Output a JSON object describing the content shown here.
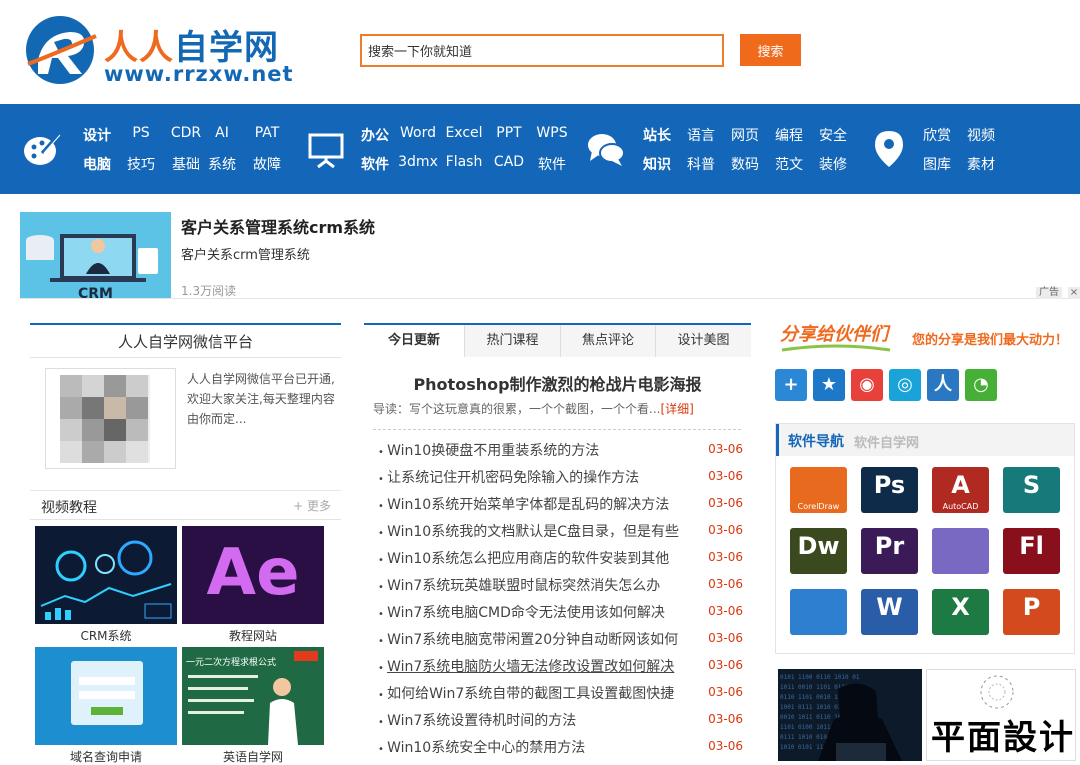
{
  "header": {
    "logo_cn_a": "人人",
    "logo_cn_b": "自学网",
    "logo_url": "www.rrzxw.net",
    "search_value": "搜索一下你就知道",
    "search_button": "搜索"
  },
  "nav": {
    "design_top": [
      "设计",
      "PS",
      "CDR",
      "AI",
      "PAT"
    ],
    "design_bottom": [
      "电脑",
      "技巧",
      "基础",
      "系统",
      "故障"
    ],
    "office_top": [
      "办公",
      "Word",
      "Excel",
      "PPT",
      "WPS"
    ],
    "office_bottom": [
      "软件",
      "3dmx",
      "Flash",
      "CAD",
      "软件"
    ],
    "web_top": [
      "站长",
      "语言",
      "网页",
      "编程",
      "安全"
    ],
    "web_bottom": [
      "知识",
      "科普",
      "数码",
      "范文",
      "装修"
    ],
    "fun_top": [
      "欣赏",
      "视频"
    ],
    "fun_bottom": [
      "图库",
      "素材"
    ]
  },
  "ad": {
    "title": "客户关系管理系统crm系统",
    "desc": "客户关系crm管理系统",
    "views": "1.3万阅读",
    "image_label": "CRM",
    "tag": "广告",
    "close": "×"
  },
  "wechat": {
    "title": "人人自学网微信平台",
    "text": "人人自学网微信平台已开通,欢迎大家关注,每天整理内容由你而定..."
  },
  "video": {
    "title": "视频教程",
    "more": "+ 更多",
    "items": [
      "CRM系统",
      "教程网站",
      "域名查询申请",
      "英语自学网"
    ],
    "thumb_ae": "Ae",
    "thumb_english": "一元二次方程求根公式"
  },
  "tabs": [
    "今日更新",
    "热门课程",
    "焦点评论",
    "设计美图"
  ],
  "featured": {
    "title": "Photoshop制作激烈的枪战片电影海报",
    "intro": "导读：写个这玩意真的很累，一个个截图，一个个看...",
    "more": "[详细]"
  },
  "news": [
    {
      "title": "Win10换硬盘不用重装系统的方法",
      "date": "03-06"
    },
    {
      "title": "让系统记住开机密码免除输入的操作方法",
      "date": "03-06"
    },
    {
      "title": "Win10系统开始菜单字体都是乱码的解决方法",
      "date": "03-06"
    },
    {
      "title": "Win10系统我的文档默认是C盘目录，但是有些",
      "date": "03-06"
    },
    {
      "title": "Win10系统怎么把应用商店的软件安装到其他",
      "date": "03-06"
    },
    {
      "title": "Win7系统玩英雄联盟时鼠标突然消失怎么办",
      "date": "03-06"
    },
    {
      "title": "Win7系统电脑CMD命令无法使用该如何解决",
      "date": "03-06"
    },
    {
      "title": "Win7系统电脑宽带闲置20分钟自动断网该如何",
      "date": "03-06"
    },
    {
      "title": "Win7系统电脑防火墙无法修改设置改如何解决",
      "date": "03-06"
    },
    {
      "title": "如何给Win7系统自带的截图工具设置截图快捷",
      "date": "03-06"
    },
    {
      "title": "Win7系统设置待机时间的方法",
      "date": "03-06"
    },
    {
      "title": "Win10系统安全中心的禁用方法",
      "date": "03-06"
    }
  ],
  "share": {
    "banner": "分享给伙伴们",
    "slogan": "您的分享是我们最大动力！"
  },
  "softnav": {
    "title": "软件导航",
    "subtitle": "软件自学网",
    "apps": [
      {
        "name": "coreldraw-icon",
        "big": "",
        "small": "CorelDraw",
        "color": "#e86a1e"
      },
      {
        "name": "photoshop-icon",
        "big": "Ps",
        "small": "",
        "color": "#0f2b4a"
      },
      {
        "name": "autocad-icon",
        "big": "A",
        "small": "AutoCAD",
        "color": "#b02a21"
      },
      {
        "name": "3dsmax-icon",
        "big": "S",
        "small": "",
        "color": "#167a7a"
      },
      {
        "name": "dreamweaver-icon",
        "big": "Dw",
        "small": "",
        "color": "#3b4a1e"
      },
      {
        "name": "premiere-icon",
        "big": "Pr",
        "small": "",
        "color": "#3a1b57"
      },
      {
        "name": "camera-icon",
        "big": "",
        "small": "",
        "color": "#7a69c2"
      },
      {
        "name": "flash-icon",
        "big": "Fl",
        "small": "",
        "color": "#8a0f1c"
      },
      {
        "name": "windows-icon",
        "big": "",
        "small": "",
        "color": "#2f7fd1"
      },
      {
        "name": "word-icon",
        "big": "W",
        "small": "",
        "color": "#2a5da8"
      },
      {
        "name": "excel-icon",
        "big": "X",
        "small": "",
        "color": "#1e7a43"
      },
      {
        "name": "powerpoint-icon",
        "big": "P",
        "small": "",
        "color": "#d24a1e"
      }
    ]
  },
  "promo": {
    "design_text": "平面設计"
  }
}
